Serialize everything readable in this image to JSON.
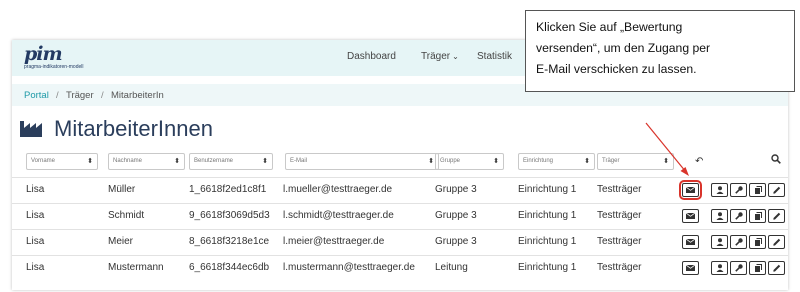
{
  "logo": {
    "mark": "pim",
    "subtitle": "pragma-indikatoren-modell"
  },
  "nav": {
    "dashboard": "Dashboard",
    "traeger": "Träger",
    "statistik": "Statistik"
  },
  "breadcrumb": {
    "portal": "Portal",
    "sep1": "/",
    "traeger": "Träger",
    "sep2": "/",
    "current": "MitarbeiterIn"
  },
  "page_title": "MitarbeiterInnen",
  "filters": {
    "vorname": "Vorname",
    "nachname": "Nachname",
    "benutzername": "Benutzername",
    "email": "E-Mail",
    "gruppe": "Gruppe",
    "einrichtung": "Einrichtung",
    "traeger": "Träger",
    "sort_glyph": "⬍",
    "undo_glyph": "↶"
  },
  "rows": [
    {
      "vorname": "Lisa",
      "nachname": "Müller",
      "benutzername": "1_6618f2ed1c8f1",
      "email": "l.mueller@testtraeger.de",
      "gruppe": "Gruppe 3",
      "einrichtung": "Einrichtung 1",
      "traeger": "Testträger"
    },
    {
      "vorname": "Lisa",
      "nachname": "Schmidt",
      "benutzername": "9_6618f3069d5d3",
      "email": "l.schmidt@testtraeger.de",
      "gruppe": "Gruppe 3",
      "einrichtung": "Einrichtung 1",
      "traeger": "Testträger"
    },
    {
      "vorname": "Lisa",
      "nachname": "Meier",
      "benutzername": "8_6618f3218e1ce",
      "email": "l.meier@testtraeger.de",
      "gruppe": "Gruppe 3",
      "einrichtung": "Einrichtung 1",
      "traeger": "Testträger"
    },
    {
      "vorname": "Lisa",
      "nachname": "Mustermann",
      "benutzername": "6_6618f344ec6db",
      "email": "l.mustermann@testtraeger.de",
      "gruppe": "Leitung",
      "einrichtung": "Einrichtung 1",
      "traeger": "Testträger"
    }
  ],
  "row_actions": [
    "envelope-icon",
    "user-icon",
    "key-icon",
    "copy-icon",
    "pencil-icon"
  ],
  "callout": {
    "line1": "Klicken Sie auf „Bewertung",
    "line2": "versenden“, um den Zugang per",
    "line3": "E-Mail verschicken zu lassen."
  },
  "colors": {
    "accent": "#1e9aa7",
    "brand": "#233a63",
    "highlight": "#d9342b"
  }
}
